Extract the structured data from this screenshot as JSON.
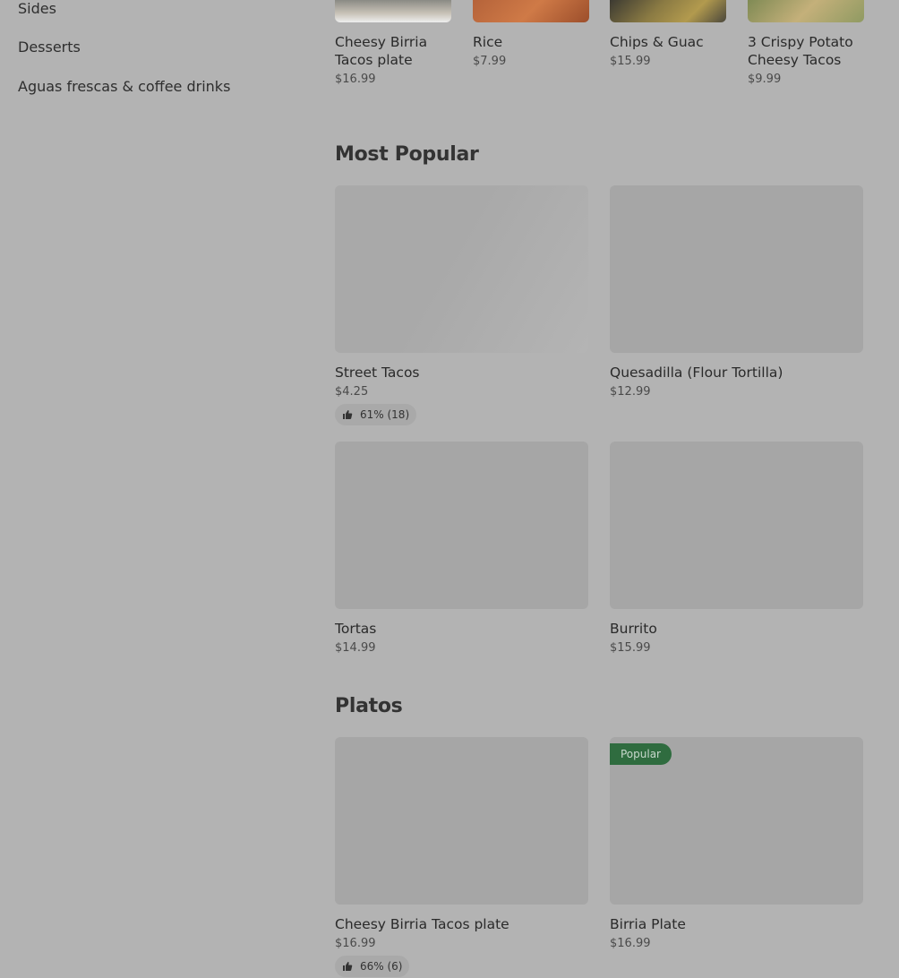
{
  "sidebar": {
    "items": [
      {
        "label": "Sides"
      },
      {
        "label": "Desserts"
      },
      {
        "label": "Aguas frescas & coffee drinks"
      }
    ]
  },
  "featured_strip": {
    "items": [
      {
        "name": "Cheesy Birria Tacos plate",
        "price": "$16.99"
      },
      {
        "name": "Rice",
        "price": "$7.99"
      },
      {
        "name": "Chips & Guac",
        "price": "$15.99"
      },
      {
        "name": "3 Crispy Potato Cheesy Tacos",
        "price": "$9.99"
      }
    ]
  },
  "most_popular": {
    "title": "Most Popular",
    "items": [
      {
        "name": "Street Tacos",
        "price": "$4.25",
        "rating": "61% (18)"
      },
      {
        "name": "Quesadilla (Flour Tortilla)",
        "price": "$12.99"
      },
      {
        "name": "Tortas",
        "price": "$14.99"
      },
      {
        "name": "Burrito",
        "price": "$15.99"
      }
    ]
  },
  "platos": {
    "title": "Platos",
    "items": [
      {
        "name": "Cheesy Birria Tacos plate",
        "price": "$16.99",
        "rating": "66% (6)"
      },
      {
        "name": "Birria Plate",
        "price": "$16.99",
        "badge": "Popular"
      }
    ]
  },
  "colors": {
    "overlay_bg": "#b3b3b3",
    "badge_green": "#2f6c3f"
  },
  "icons": {
    "rating": "thumbs-up-icon"
  }
}
